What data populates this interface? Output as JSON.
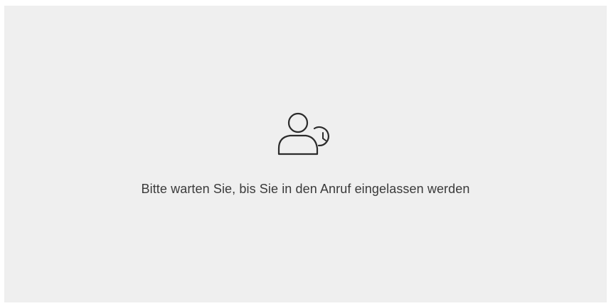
{
  "lobby": {
    "icon": "person-waiting-clock-icon",
    "message": "Bitte warten Sie, bis Sie in den Anruf eingelassen werden"
  },
  "colors": {
    "background": "#efefef",
    "text": "#3a3a3a",
    "icon_stroke": "#2b2b2b"
  }
}
